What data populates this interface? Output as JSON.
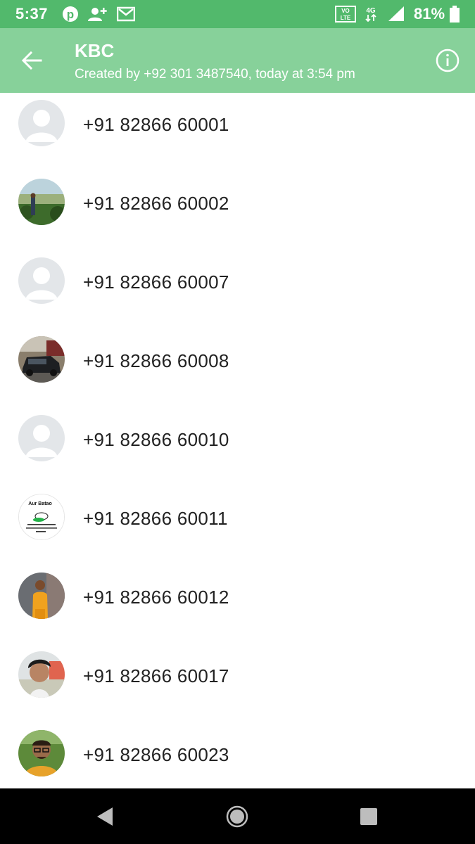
{
  "status_bar": {
    "time": "5:37",
    "left_icons": [
      "pinterest-icon",
      "add-contact-icon",
      "gmail-icon"
    ],
    "right_icons": [
      "volte-icon",
      "4g-data-icon",
      "signal-icon",
      "battery-icon"
    ],
    "volte_text": "VO LTE",
    "network_text": "4G",
    "battery": "81%"
  },
  "app_bar": {
    "title": "KBC",
    "subtitle": "Created by +92 301 3487540, today at 3:54 pm"
  },
  "members": [
    {
      "number": "+91 82866 60001",
      "avatar": "default"
    },
    {
      "number": "+91 82866 60002",
      "avatar": "photo-outdoor"
    },
    {
      "number": "+91 82866 60007",
      "avatar": "default"
    },
    {
      "number": "+91 82866 60008",
      "avatar": "photo-car"
    },
    {
      "number": "+91 82866 60010",
      "avatar": "default"
    },
    {
      "number": "+91 82866 60011",
      "avatar": "sticker",
      "avatar_text": "Aur Batao"
    },
    {
      "number": "+91 82866 60012",
      "avatar": "photo-person-orange"
    },
    {
      "number": "+91 82866 60017",
      "avatar": "photo-selfie"
    },
    {
      "number": "+91 82866 60023",
      "avatar": "photo-selfie-glasses"
    }
  ],
  "colors": {
    "status_bar": "#52b96c",
    "app_bar": "#87d19a",
    "nav_bar": "#000000",
    "text": "#222222"
  }
}
